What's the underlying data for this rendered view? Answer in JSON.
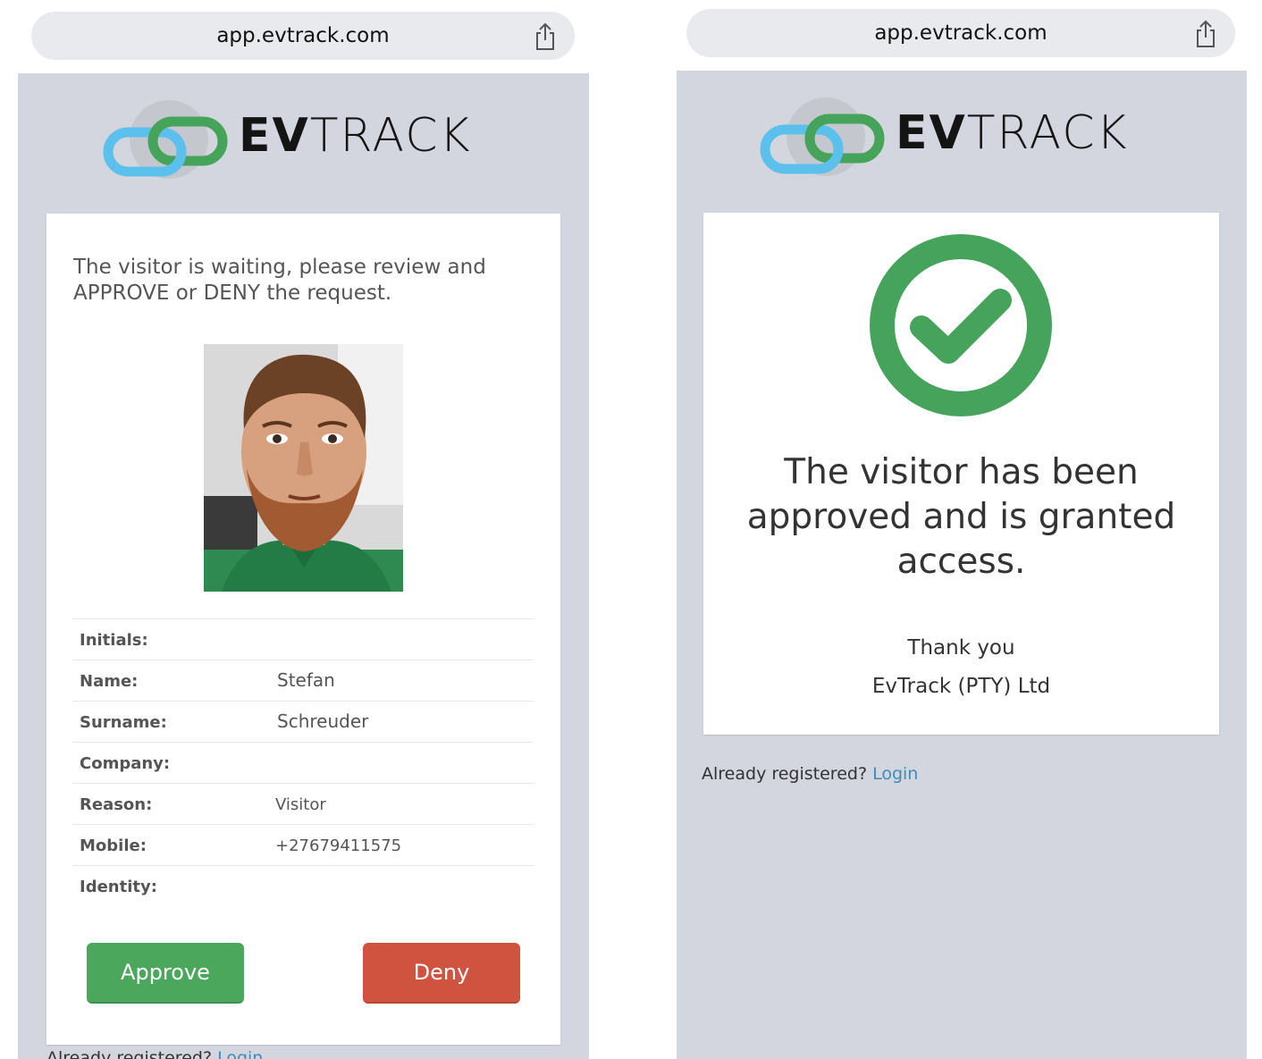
{
  "approval_screen": {
    "url": "app.evtrack.com",
    "logo_text_bold": "EV",
    "logo_text_light": "TRACK",
    "intro_text": "The visitor is waiting, please review and APPROVE or DENY the request.",
    "fields": [
      {
        "label": "Initials:",
        "value": ""
      },
      {
        "label": "Name:",
        "value": "Stefan"
      },
      {
        "label": "Surname:",
        "value": "Schreuder"
      },
      {
        "label": "Company:",
        "value": ""
      },
      {
        "label": "Reason:",
        "value": "Visitor"
      },
      {
        "label": "Mobile:",
        "value": "+27679411575"
      },
      {
        "label": "Identity:",
        "value": ""
      }
    ],
    "approve_label": "Approve",
    "deny_label": "Deny",
    "footer_text": "Already registered?",
    "footer_link": "Login"
  },
  "approved_screen": {
    "url": "app.evtrack.com",
    "logo_text_bold": "EV",
    "logo_text_light": "TRACK",
    "message": "The visitor has been approved and is granted access.",
    "thanks_line": "Thank you",
    "company_line": "EvTrack (PTY) Ltd",
    "footer_text": "Already registered?",
    "footer_link": "Login"
  },
  "colors": {
    "approve": "#4aa75c",
    "deny": "#d0533f",
    "success_ring": "#45a35b",
    "link": "#3c8dbc",
    "page_bg": "#d3d6de"
  },
  "icons": {
    "share": "share-icon",
    "success": "check-circle-icon",
    "logo": "evtrack-chain-logo"
  }
}
